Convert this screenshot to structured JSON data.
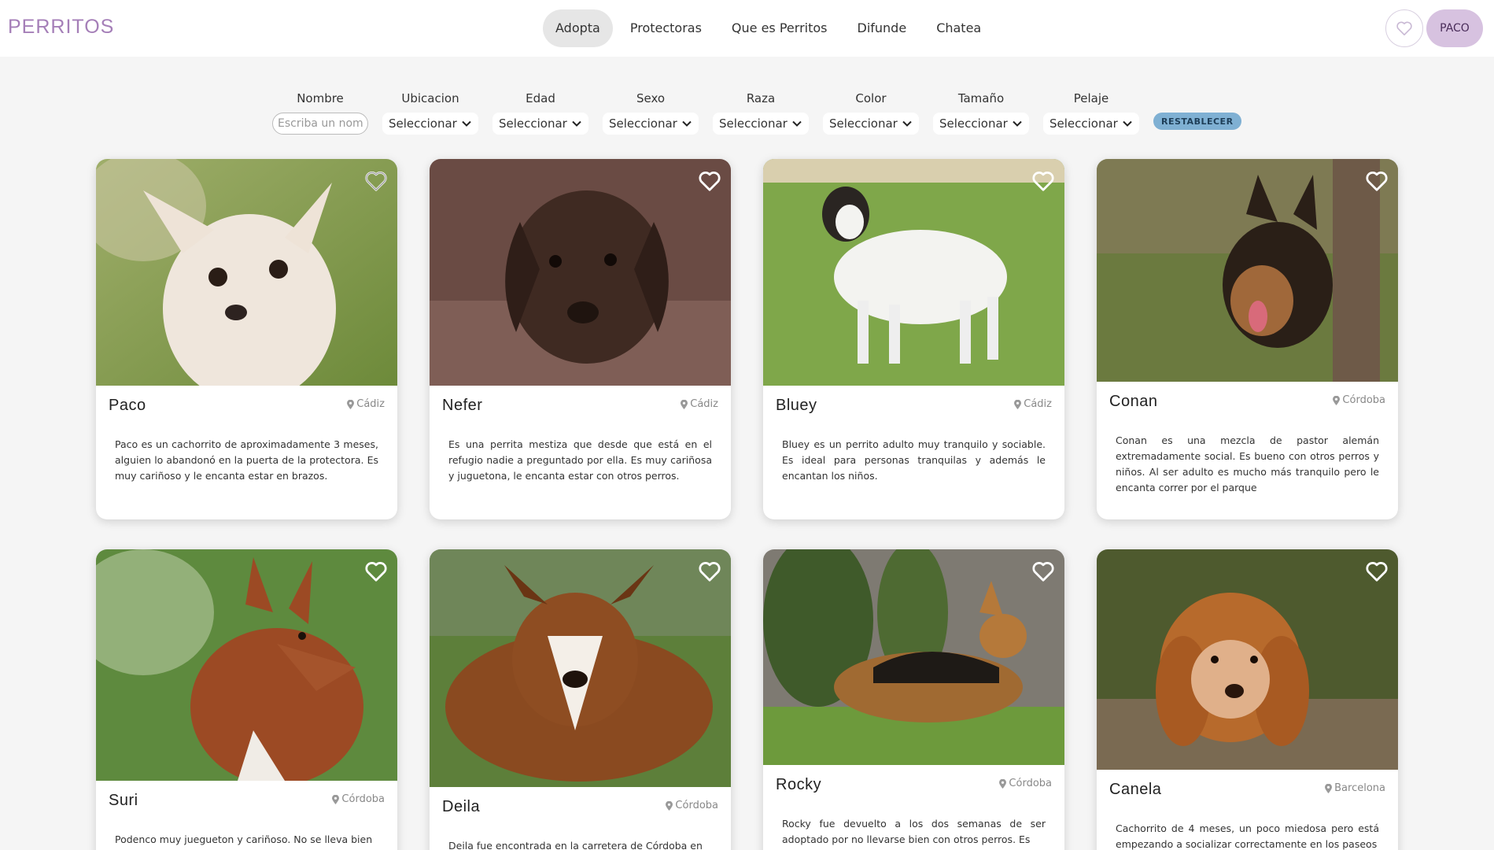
{
  "header": {
    "logo": "PERRITOS",
    "nav": [
      "Adopta",
      "Protectoras",
      "Que es Perritos",
      "Difunde",
      "Chatea"
    ],
    "user_label": "PACO"
  },
  "filters": {
    "name_label": "Nombre",
    "name_placeholder": "Escriba un nombre",
    "selects": [
      {
        "label": "Ubicacion",
        "value": "Seleccionar"
      },
      {
        "label": "Edad",
        "value": "Seleccionar"
      },
      {
        "label": "Sexo",
        "value": "Seleccionar"
      },
      {
        "label": "Raza",
        "value": "Seleccionar"
      },
      {
        "label": "Color",
        "value": "Seleccionar"
      },
      {
        "label": "Tamaño",
        "value": "Seleccionar"
      },
      {
        "label": "Pelaje",
        "value": "Seleccionar"
      }
    ],
    "reset_label": "RESTABLECER"
  },
  "dogs": [
    {
      "name": "Paco",
      "location": "Cádiz",
      "description": "Paco es un cachorrito de aproximadamente 3 meses, alguien lo abandonó en la puerta de la protectora. Es muy cariñoso y le encanta estar en brazos."
    },
    {
      "name": "Nefer",
      "location": "Cádiz",
      "description": "Es una perrita mestiza que desde que está en el refugio nadie a preguntado por ella. Es muy cariñosa y juguetona, le encanta estar con otros perros."
    },
    {
      "name": "Bluey",
      "location": "Cádiz",
      "description": "Bluey es un perrito adulto muy tranquilo y sociable. Es ideal para personas tranquilas y además le encantan los niños."
    },
    {
      "name": "Conan",
      "location": "Córdoba",
      "description": "Conan es una mezcla de pastor alemán extremadamente social. Es bueno con otros perros y niños. Al ser adulto es mucho más tranquilo pero le encanta correr por el parque"
    },
    {
      "name": "Suri",
      "location": "Córdoba",
      "description": "Podenco muy juegueton y cariñoso. No se lleva bien"
    },
    {
      "name": "Deila",
      "location": "Córdoba",
      "description": "Deila fue encontrada en la carretera de Córdoba en"
    },
    {
      "name": "Rocky",
      "location": "Córdoba",
      "description": "Rocky fue devuelto a los dos semanas de ser adoptado por no llevarse bien con otros perros. Es"
    },
    {
      "name": "Canela",
      "location": "Barcelona",
      "description": "Cachorrito de 4 meses, un poco miedosa pero está empezando a socializar correctamente en los paseos"
    }
  ],
  "colors": {
    "logo": "#a57fb8",
    "user_button": "#d7c2e0",
    "reset_button": "#7fb0d3",
    "nav_active": "#e6e6e6"
  }
}
